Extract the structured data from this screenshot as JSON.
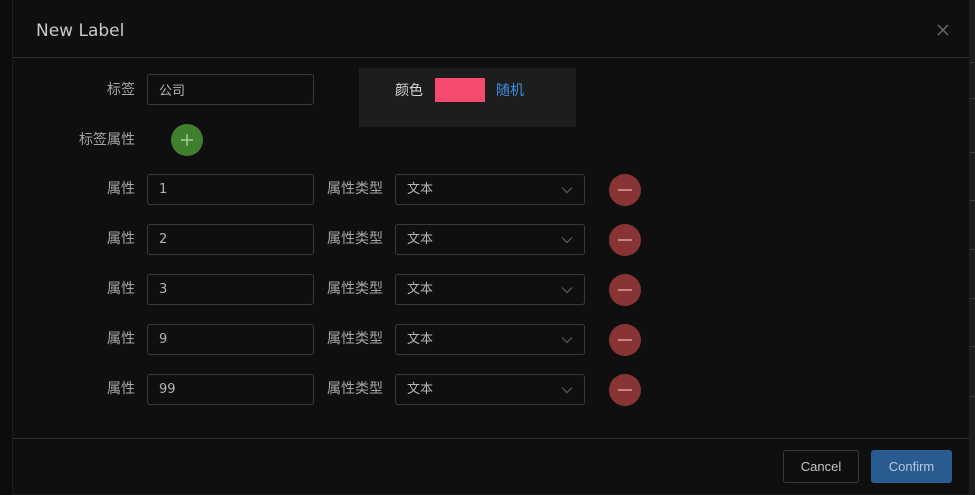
{
  "dialog": {
    "title": "New Label"
  },
  "form": {
    "label_field": {
      "label": "标签",
      "value": "公司"
    },
    "color": {
      "label": "颜色",
      "value": "#f64b6e",
      "random_label": "随机"
    },
    "properties_label": "标签属性",
    "add_icon": "plus-icon",
    "property_label": "属性",
    "type_label": "属性类型",
    "properties": [
      {
        "value": "1",
        "type": "文本"
      },
      {
        "value": "2",
        "type": "文本"
      },
      {
        "value": "3",
        "type": "文本"
      },
      {
        "value": "9",
        "type": "文本"
      },
      {
        "value": "99",
        "type": "文本"
      }
    ]
  },
  "footer": {
    "cancel_label": "Cancel",
    "confirm_label": "Confirm"
  },
  "colors": {
    "accent": "#2a5b8e",
    "add_button": "#3f7f2d",
    "remove_button": "#883434",
    "link": "#3f8fe5"
  }
}
